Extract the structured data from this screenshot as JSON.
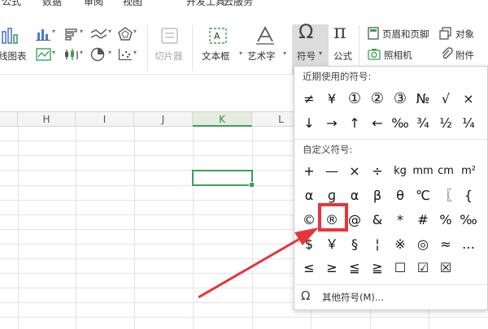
{
  "menu_tabs": [
    "公式",
    "数据",
    "审阅",
    "视图",
    "开发工具",
    "云服务"
  ],
  "ribbon": {
    "line_chart_label": "线图表",
    "screenshot_label": "切片器",
    "textbox_label": "文本框",
    "arttext_label": "艺术字",
    "symbol_label": "符号",
    "formula_label": "公式",
    "header_footer_label": "页眉和页脚",
    "object_label": "对象",
    "camera_label": "照相机",
    "attachment_label": "附件"
  },
  "sheet": {
    "columns": [
      "H",
      "I",
      "J",
      "K",
      "L"
    ],
    "active_column": "K"
  },
  "symbol_dropdown": {
    "recent_title": "近期使用的符号:",
    "recent_row1": [
      "≠",
      "¥",
      "①",
      "②",
      "③",
      "№",
      "√",
      "×"
    ],
    "recent_row2": [
      "↓",
      "→",
      "↑",
      "←",
      "‰",
      "¾",
      "½",
      "¼"
    ],
    "custom_title": "自定义符号:",
    "custom_row1": [
      "+",
      "—",
      "×",
      "÷",
      "kg",
      "mm",
      "cm",
      "m²"
    ],
    "custom_row2": [
      "α",
      "ɡ",
      "α",
      "β",
      "θ",
      "℃",
      "〖",
      "{"
    ],
    "custom_row3": [
      "©",
      "®",
      "@",
      "&",
      "*",
      "#",
      "%",
      "‰"
    ],
    "custom_row4": [
      "$",
      "￥",
      "§",
      "¦",
      "※",
      "◎",
      "≈",
      "…"
    ],
    "custom_row5": [
      "≤",
      "≥",
      "≦",
      "≧",
      "☐",
      "☑",
      "☒"
    ],
    "more_label": "其他符号(M)...",
    "highlighted_symbol": "®"
  },
  "colors": {
    "accent_green": "#3b9f55",
    "highlight_red": "#e8333a"
  }
}
